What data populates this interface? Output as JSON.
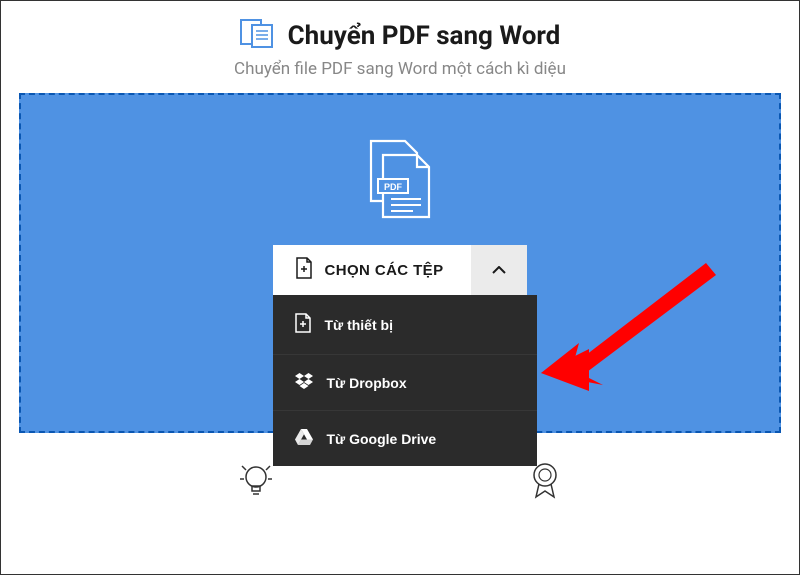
{
  "header": {
    "title": "Chuyển PDF sang Word",
    "subtitle": "Chuyển file PDF sang Word một cách kì diệu"
  },
  "dropzone": {
    "choose_label": "CHỌN CÁC TỆP",
    "menu": {
      "device": "Từ thiết bị",
      "dropbox": "Từ Dropbox",
      "gdrive": "Từ Google Drive"
    }
  },
  "colors": {
    "accent": "#4f92e3",
    "dashed": "#0a57b3",
    "menu_bg": "#2b2b2b",
    "arrow": "#ff0000"
  }
}
